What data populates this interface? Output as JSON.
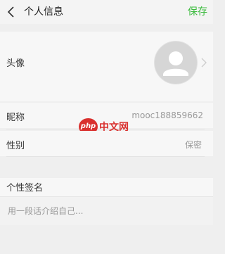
{
  "nav": {
    "title": "个人信息",
    "save_label": "保存"
  },
  "profile": {
    "avatar_label": "头像",
    "nickname_label": "昵称",
    "nickname_value": "mooc188859662",
    "gender_label": "性别",
    "gender_value": "保密",
    "signature_label": "个性签名",
    "signature_placeholder": "用一段话介绍自己..."
  },
  "watermark": {
    "badge_text": "php",
    "site_text": "中文网"
  },
  "colors": {
    "accent": "#3dbb3f",
    "watermark": "#d9302e"
  }
}
